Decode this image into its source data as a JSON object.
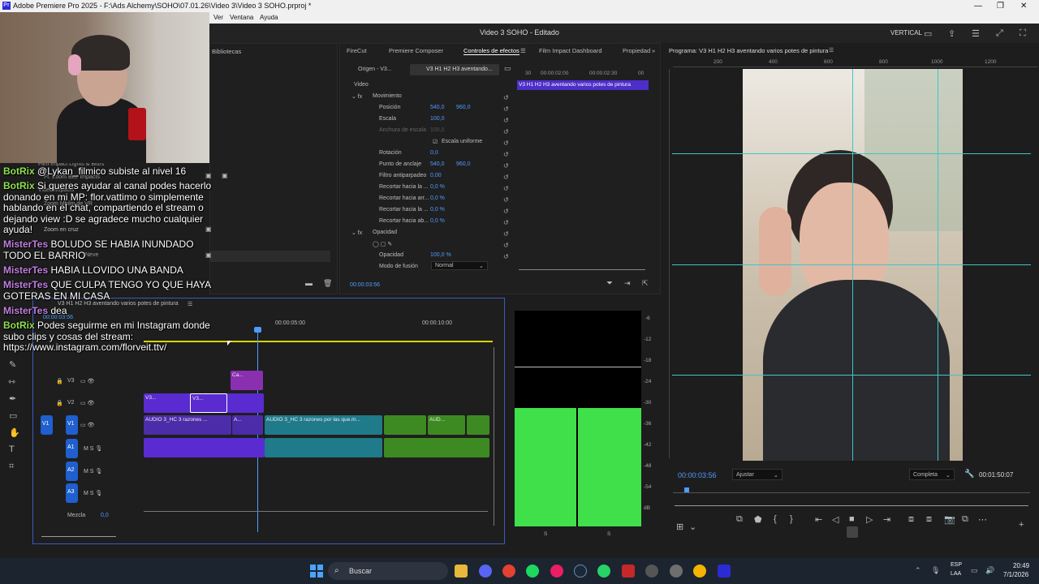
{
  "titlebar": {
    "title": "Adobe Premiere Pro 2025 - F:\\Ads Alchemy\\SOHO\\07.01.26\\Video 3\\Video 3 SOHO.prproj *",
    "app_badge": "Pr"
  },
  "menu": {
    "items": [
      "Ver",
      "Ventana",
      "Ayuda"
    ]
  },
  "header": {
    "center": "Video 3 SOHO - Editado",
    "workspace": "VERTICAL"
  },
  "left_panel": {
    "tab": "Bibliotecas"
  },
  "effects_panel": {
    "tabs": [
      "FireCut",
      "Premiere Composer",
      "Controles de efectos",
      "Film Impact Dashboard",
      "Propiedad"
    ],
    "source_tab": "Origen - V3...",
    "clip_tab": "V3 H1 H2 H3 aventando...",
    "clip_name": "V3 H1 H2 H3 aventando varios potes de pintura",
    "ruler": [
      "30",
      "00:00:02:00",
      "00:00:02:30",
      "00"
    ],
    "section_video": "Video",
    "motion": "Movimiento",
    "props": [
      {
        "label": "Posición",
        "v1": "540,0",
        "v2": "960,0"
      },
      {
        "label": "Escala",
        "v1": "100,0",
        "v2": ""
      },
      {
        "label": "Anchura de escala",
        "v1": "100,0",
        "v2": ""
      },
      {
        "label": "Rotación",
        "v1": "0,0",
        "v2": ""
      },
      {
        "label": "Punto de anclaje",
        "v1": "540,0",
        "v2": "960,0"
      },
      {
        "label": "Filtro antiparpadeo",
        "v1": "0,00",
        "v2": ""
      },
      {
        "label": "Recortar hacia la ...",
        "v1": "0,0 %",
        "v2": ""
      },
      {
        "label": "Recortar hacia arr...",
        "v1": "0,0 %",
        "v2": ""
      },
      {
        "label": "Recortar hacia la ...",
        "v1": "0,0 %",
        "v2": ""
      },
      {
        "label": "Recortar hacia ab...",
        "v1": "0,0 %",
        "v2": ""
      }
    ],
    "uniform_scale": "Escala uniforme",
    "opacity_section": "Opacidad",
    "opacity_label": "Opacidad",
    "opacity_value": "100,0 %",
    "blend_label": "Modo de fusión",
    "blend_value": "Normal",
    "timecode": "00:00:03:56"
  },
  "effects_list": {
    "items": [
      "Film Impact Lights & Blurs",
      "Ft. Zoom Blur Impacts",
      "Video Impacts",
      "Zoom Mbilm de VR",
      "Zoom en cruz",
      "Neve"
    ]
  },
  "chat": {
    "messages": [
      {
        "user": "BotRix",
        "color": "#8fe04d",
        "text": "@Lykan_filmico subiste al nivel 16"
      },
      {
        "user": "BotRix",
        "color": "#8fe04d",
        "text": "Si queres ayudar al canal podes hacerlo donando en mi MP: flor.vattimo o simplemente hablando en el chat, compartiendo el stream o dejando view :D se agradece mucho cualquier ayuda!"
      },
      {
        "user": "MisterTes",
        "color": "#c07fe0",
        "text": "BOLUDO SE HABIA INUNDADO TODO EL BARRIO"
      },
      {
        "user": "MisterTes",
        "color": "#c07fe0",
        "text": "HABIA LLOVIDO UNA BANDA"
      },
      {
        "user": "MisterTes",
        "color": "#c07fe0",
        "text": "QUE CULPA TENGO YO QUE HAYA GOTERAS EN MI CASA"
      },
      {
        "user": "MisterTes",
        "color": "#c07fe0",
        "text": "dea"
      },
      {
        "user": "BotRix",
        "color": "#8fe04d",
        "text": "Podes seguirme en mi Instagram donde subo clips y cosas del stream: https://www.instagram.com/florveit.ttv/"
      }
    ]
  },
  "timeline": {
    "sequence": "V3 H1 H2 H3 aventando varios potes de pintura",
    "timecode": "00:00:03:56",
    "ruler": [
      "00:00:05:00",
      "00:00:10:00"
    ],
    "tracks_video": [
      "V3",
      "V2",
      "V1"
    ],
    "tracks_audio": [
      "A1",
      "A2",
      "A3"
    ],
    "source_patch": "V1",
    "mix_label": "Mezcla",
    "mix_value": "0,0",
    "clips": {
      "v3_a": "Ca...",
      "v2_a": "V3...",
      "v2_b": "V3...",
      "v1_a": "AUDIO 3_HC 3 razones ...",
      "v1_b": "A...",
      "v1_c": "AUDIO 3_HC 3 razones por las que.m...",
      "v1_d": "AUD..."
    }
  },
  "meters": {
    "scale": [
      "-6",
      "-12",
      "-18",
      "-24",
      "-30",
      "-36",
      "-42",
      "-48",
      "-54",
      "dB"
    ],
    "bottom": [
      "S",
      "S"
    ],
    "level": 0.55
  },
  "program": {
    "title": "Programa: V3 H1 H2 H3 aventando varios potes de pintura",
    "ruler_h": [
      "200",
      "400",
      "600",
      "800",
      "1000",
      "1200"
    ],
    "timecode": "00:00:03:56",
    "fit": "Ajustar",
    "quality": "Completa",
    "duration": "00:01:50:07"
  },
  "taskbar": {
    "search": "Buscar",
    "lang1": "ESP",
    "lang2": "LAA",
    "time": "20:49",
    "date": "7/1/2026"
  }
}
